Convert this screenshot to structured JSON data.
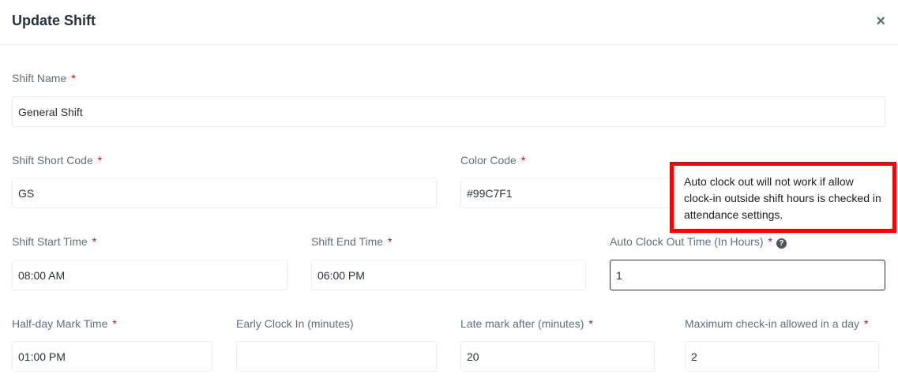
{
  "modal": {
    "title": "Update Shift",
    "close_symbol": "×"
  },
  "required_marker": "*",
  "fields": {
    "shift_name": {
      "label": "Shift Name",
      "value": "General Shift"
    },
    "shift_short_code": {
      "label": "Shift Short Code",
      "value": "GS"
    },
    "color_code": {
      "label": "Color Code",
      "value": "#99C7F1"
    },
    "shift_start_time": {
      "label": "Shift Start Time",
      "value": "08:00 AM"
    },
    "shift_end_time": {
      "label": "Shift End Time",
      "value": "06:00 PM"
    },
    "auto_clock_out_time": {
      "label": "Auto Clock Out Time (In Hours)",
      "value": "1",
      "help_icon": "question-circle-icon",
      "help_symbol": "?"
    },
    "half_day_mark_time": {
      "label": "Half-day Mark Time",
      "value": "01:00 PM"
    },
    "early_clock_in": {
      "label": "Early Clock In (minutes)",
      "value": ""
    },
    "late_mark_after": {
      "label": "Late mark after (minutes)",
      "value": "20"
    },
    "max_checkin": {
      "label": "Maximum check-in allowed in a day",
      "value": "2"
    }
  },
  "tooltip": {
    "text": "Auto clock out will not work if allow clock-in outside shift hours is checked in attendance settings."
  },
  "colors": {
    "required": "#d30000",
    "highlight_border": "#ff0000",
    "label": "#616e80",
    "border": "#e8eef3"
  }
}
